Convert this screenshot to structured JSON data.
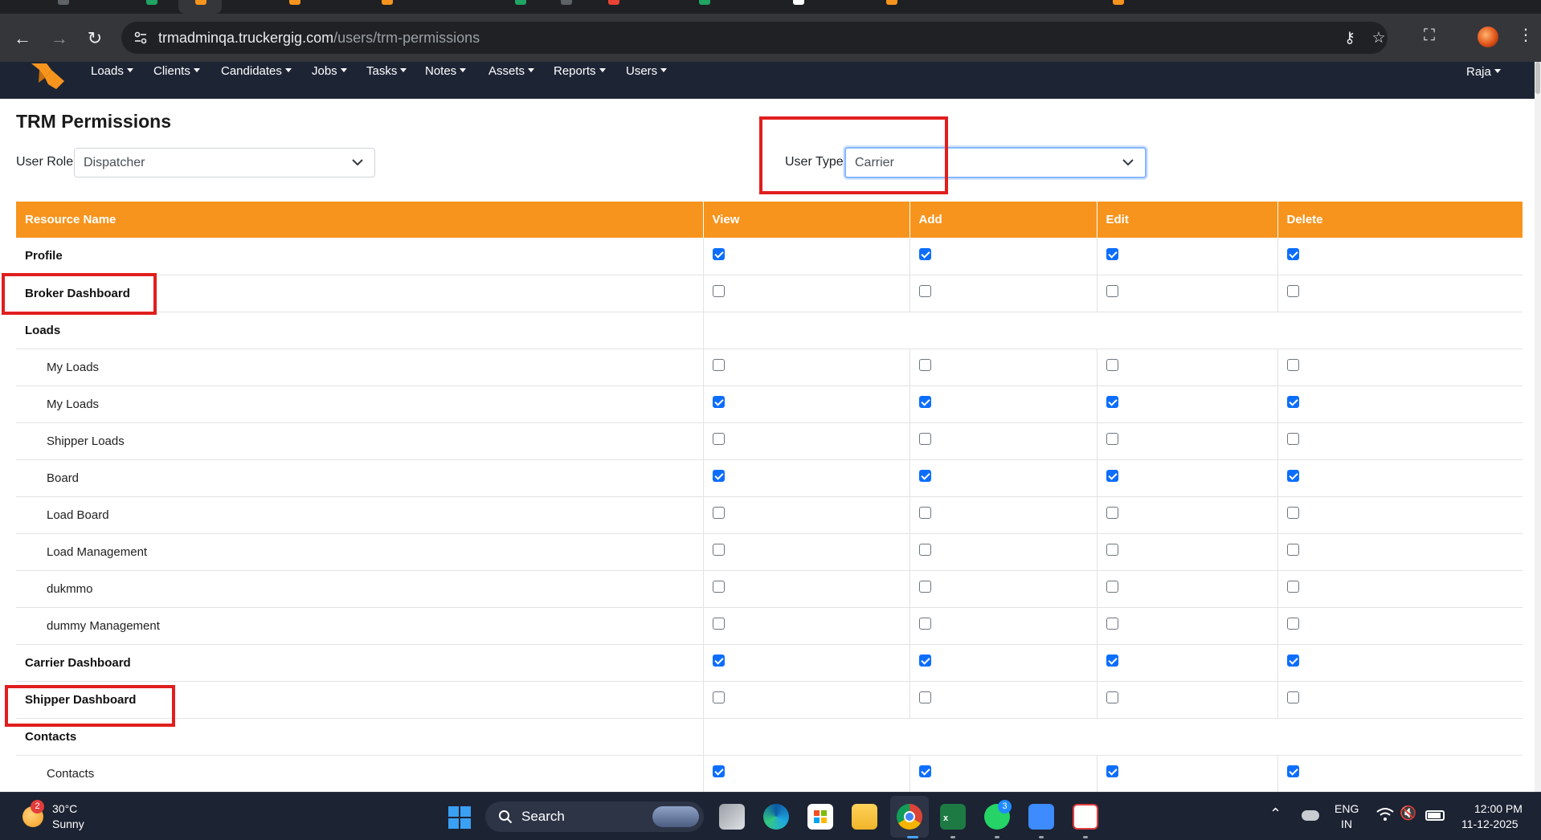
{
  "browser": {
    "url_domain": "trmadminqa.truckergig.com",
    "url_path": "/users/trm-permissions"
  },
  "navbar": {
    "items": [
      {
        "label": "Loads"
      },
      {
        "label": "Clients"
      },
      {
        "label": "Candidates"
      },
      {
        "label": "Jobs"
      },
      {
        "label": "Tasks"
      },
      {
        "label": "Notes"
      },
      {
        "label": "Assets"
      },
      {
        "label": "Reports"
      },
      {
        "label": "Users"
      }
    ],
    "user": "Raja"
  },
  "page": {
    "title": "TRM Permissions",
    "user_role_label": "User Role :",
    "user_role_value": "Dispatcher",
    "user_type_label": "User Type :",
    "user_type_value": "Carrier"
  },
  "table": {
    "headers": [
      "Resource Name",
      "View",
      "Add",
      "Edit",
      "Delete"
    ],
    "rows": [
      {
        "name": "Profile",
        "level": "group",
        "perms": [
          true,
          true,
          true,
          true
        ]
      },
      {
        "name": "Broker Dashboard",
        "level": "group",
        "perms": [
          false,
          false,
          false,
          false
        ]
      },
      {
        "name": "Loads",
        "level": "group",
        "perms": null
      },
      {
        "name": "My Loads",
        "level": "child",
        "perms": [
          false,
          false,
          false,
          false
        ]
      },
      {
        "name": "My Loads",
        "level": "child",
        "perms": [
          true,
          true,
          true,
          true
        ]
      },
      {
        "name": "Shipper Loads",
        "level": "child",
        "perms": [
          false,
          false,
          false,
          false
        ]
      },
      {
        "name": "Board",
        "level": "child",
        "perms": [
          true,
          true,
          true,
          true
        ]
      },
      {
        "name": "Load Board",
        "level": "child",
        "perms": [
          false,
          false,
          false,
          false
        ]
      },
      {
        "name": "Load Management",
        "level": "child",
        "perms": [
          false,
          false,
          false,
          false
        ]
      },
      {
        "name": "dukmmo",
        "level": "child",
        "perms": [
          false,
          false,
          false,
          false
        ]
      },
      {
        "name": "dummy Management",
        "level": "child",
        "perms": [
          false,
          false,
          false,
          false
        ]
      },
      {
        "name": "Carrier Dashboard",
        "level": "group",
        "perms": [
          true,
          true,
          true,
          true
        ]
      },
      {
        "name": "Shipper Dashboard",
        "level": "group",
        "perms": [
          false,
          false,
          false,
          false
        ]
      },
      {
        "name": "Contacts",
        "level": "group",
        "perms": null
      },
      {
        "name": "Contacts",
        "level": "child",
        "perms": [
          true,
          true,
          true,
          true
        ]
      }
    ]
  },
  "colors": {
    "table_header": "#f7941d",
    "navbar": "#1d2535",
    "highlight": "#e01e1e",
    "checkbox_checked": "#0d6efd"
  },
  "taskbar": {
    "weather_temp": "30°C",
    "weather_desc": "Sunny",
    "weather_badge": "2",
    "search_label": "Search",
    "whatsapp_badge": "3",
    "lang_top": "ENG",
    "lang_bottom": "IN",
    "time": "12:00 PM",
    "date": "11-12-2025"
  }
}
